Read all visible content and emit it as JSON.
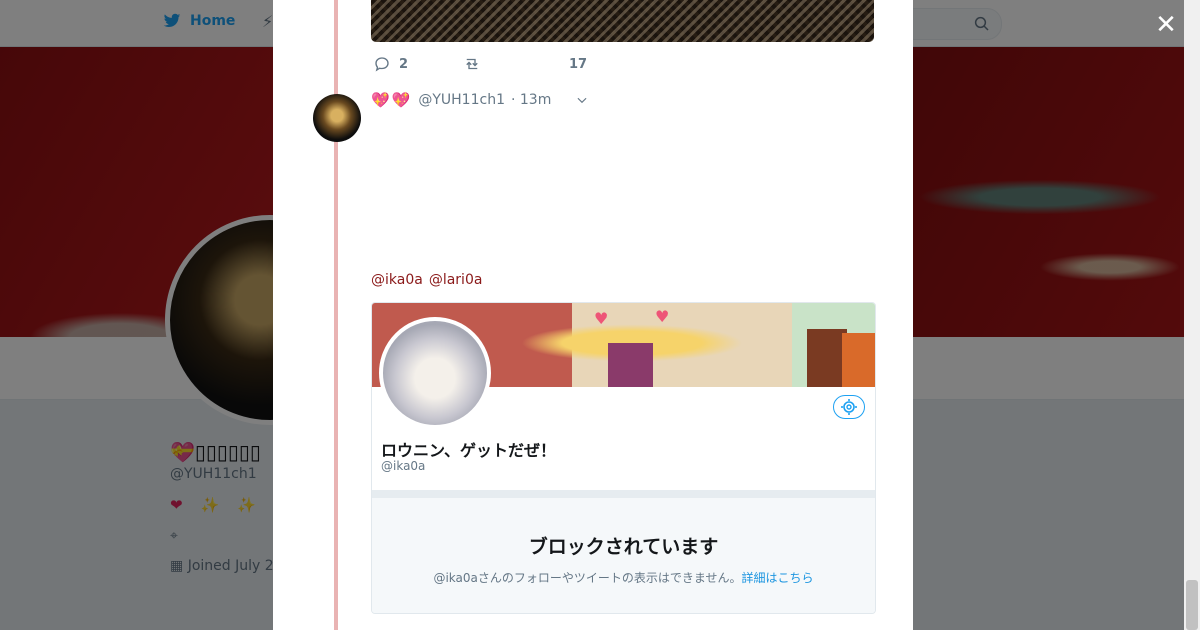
{
  "nav": {
    "home_label": "Home"
  },
  "profile": {
    "name": "💝▯▯▯▯▯▯",
    "handle": "@YUH11ch1",
    "bio_emojis": "❤✨✨",
    "joined": "Joined July 2"
  },
  "tweet_prev": {
    "replies": "2",
    "likes": "17"
  },
  "tweet": {
    "display_emojis": "💖💖",
    "handle": "@YUH11ch1",
    "time": "· 13m",
    "mentions": [
      "@ika0a",
      "@lari0a"
    ]
  },
  "card": {
    "name": "ロウニン、ゲットだぜ！",
    "handle": "@ika0a",
    "blocked_title": "ブロックされています",
    "blocked_text": "@ika0aさんのフォローやツイートの表示はできません。",
    "blocked_link": "詳細はこちら"
  },
  "colors": {
    "brand": "#1da1f2",
    "thread_line": "#e9b3b3",
    "mention": "#8b1a1a",
    "heart": "#e0245e"
  }
}
